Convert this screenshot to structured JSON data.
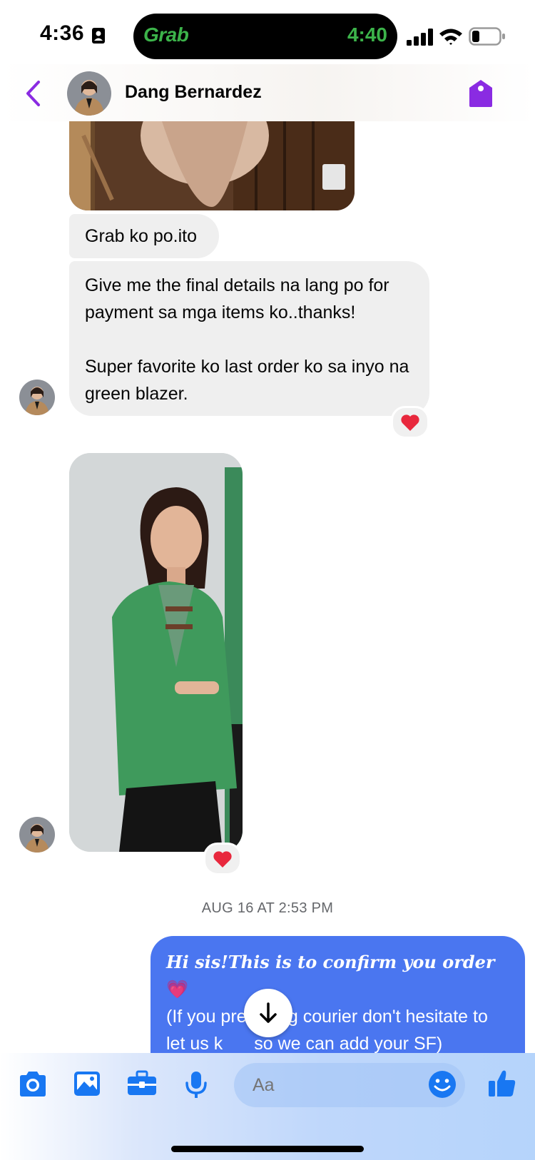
{
  "status_bar": {
    "time": "4:36",
    "live_activity_brand": "Grab",
    "live_activity_time": "4:40"
  },
  "header": {
    "contact_name": "Dang Bernardez"
  },
  "messages": {
    "m1": "Grab ko po.ito",
    "m2_line1": "Give me the final details na lang po for payment sa mga items ko..thanks!",
    "m2_line2": "Super favorite ko last order ko sa inyo na green blazer.",
    "reaction1": "❤️",
    "reaction2": "❤️",
    "timestamp": "AUG 16 AT 2:53 PM",
    "outgoing_line1": "Hi sis!This is to confirm you order",
    "outgoing_emoji": "💗",
    "outgoing_line2": "(If you prefer reg courier don't hesitate to let us k",
    "outgoing_line2b": "so we can add your SF)",
    "outgoing_divider": "=========================================="
  },
  "composer": {
    "placeholder": "Aa"
  },
  "colors": {
    "accent": "#8a2be2",
    "outgoing_bubble": "#4a76f0",
    "messenger_blue": "#1877f2",
    "grab_green": "#3cb34a"
  }
}
